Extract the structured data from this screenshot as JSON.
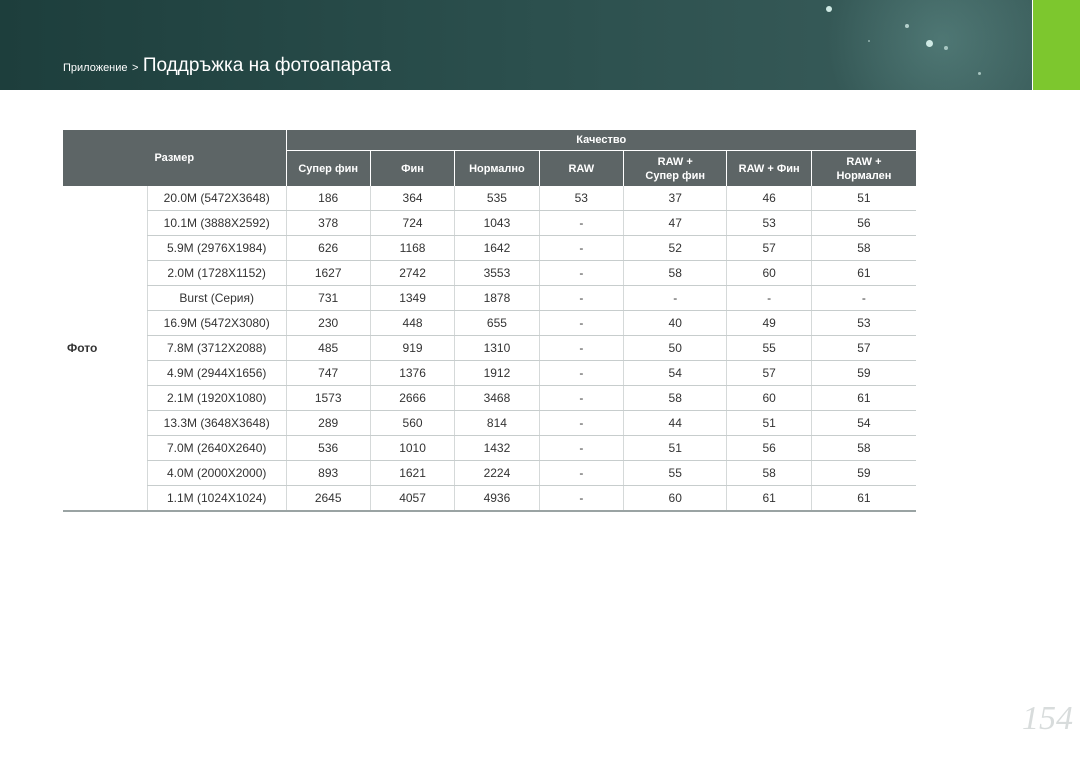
{
  "header": {
    "breadcrumb_parent": "Приложение",
    "separator": ">",
    "title": "Поддръжка на фотоапарата"
  },
  "table": {
    "size_header": "Размер",
    "quality_header": "Качество",
    "columns": [
      "Супер фин",
      "Фин",
      "Нормално",
      "RAW",
      "RAW + Супер фин",
      "RAW + Фин",
      "RAW + Нормален"
    ],
    "category": "Фото",
    "rows": [
      {
        "size": "20.0M (5472X3648)",
        "values": [
          "186",
          "364",
          "535",
          "53",
          "37",
          "46",
          "51"
        ]
      },
      {
        "size": "10.1M (3888X2592)",
        "values": [
          "378",
          "724",
          "1043",
          "-",
          "47",
          "53",
          "56"
        ]
      },
      {
        "size": "5.9M (2976X1984)",
        "values": [
          "626",
          "1168",
          "1642",
          "-",
          "52",
          "57",
          "58"
        ]
      },
      {
        "size": "2.0M (1728X1152)",
        "values": [
          "1627",
          "2742",
          "3553",
          "-",
          "58",
          "60",
          "61"
        ]
      },
      {
        "size": "Burst (Серия)",
        "values": [
          "731",
          "1349",
          "1878",
          "-",
          "-",
          "-",
          "-"
        ]
      },
      {
        "size": "16.9M (5472X3080)",
        "values": [
          "230",
          "448",
          "655",
          "-",
          "40",
          "49",
          "53"
        ]
      },
      {
        "size": "7.8M (3712X2088)",
        "values": [
          "485",
          "919",
          "1310",
          "-",
          "50",
          "55",
          "57"
        ]
      },
      {
        "size": "4.9M (2944X1656)",
        "values": [
          "747",
          "1376",
          "1912",
          "-",
          "54",
          "57",
          "59"
        ]
      },
      {
        "size": "2.1M (1920X1080)",
        "values": [
          "1573",
          "2666",
          "3468",
          "-",
          "58",
          "60",
          "61"
        ]
      },
      {
        "size": "13.3M (3648X3648)",
        "values": [
          "289",
          "560",
          "814",
          "-",
          "44",
          "51",
          "54"
        ]
      },
      {
        "size": "7.0M (2640X2640)",
        "values": [
          "536",
          "1010",
          "1432",
          "-",
          "51",
          "56",
          "58"
        ]
      },
      {
        "size": "4.0M (2000X2000)",
        "values": [
          "893",
          "1621",
          "2224",
          "-",
          "55",
          "58",
          "59"
        ]
      },
      {
        "size": "1.1M (1024X1024)",
        "values": [
          "2645",
          "4057",
          "4936",
          "-",
          "60",
          "61",
          "61"
        ]
      }
    ]
  },
  "page_number": "154",
  "colors": {
    "header_bg": "#2b4f4d",
    "accent_green": "#7dc72e",
    "table_header_bg": "#5d6566"
  }
}
